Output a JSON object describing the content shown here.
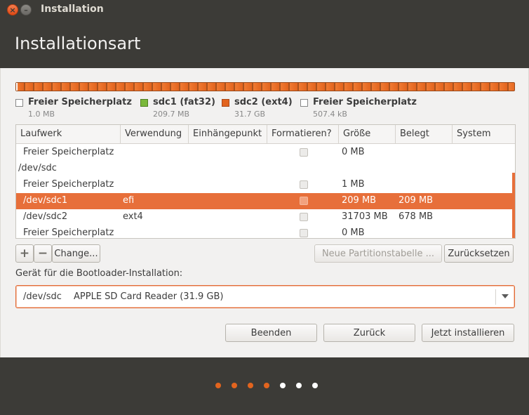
{
  "window": {
    "title": "Installation",
    "close_icon": "close-icon",
    "minimize_icon": "minimize-icon"
  },
  "header": {
    "title": "Installationsart"
  },
  "legend": [
    {
      "label": "Freier Speicherplatz",
      "size": "1.0 MB",
      "color": "#ffffff"
    },
    {
      "label": "sdc1 (fat32)",
      "size": "209.7 MB",
      "color": "#7ab83a"
    },
    {
      "label": "sdc2 (ext4)",
      "size": "31.7 GB",
      "color": "#e2641e"
    },
    {
      "label": "Freier Speicherplatz",
      "size": "507.4 kB",
      "color": "#ffffff"
    }
  ],
  "table": {
    "columns": [
      "Laufwerk",
      "Verwendung",
      "Einhängepunkt",
      "Formatieren?",
      "Größe",
      "Belegt",
      "System"
    ],
    "rows": [
      {
        "device": "Freier Speicherplatz",
        "usage": "",
        "mount": "",
        "format": true,
        "size": "0 MB",
        "used": "",
        "system": "",
        "selected": false,
        "indent": true
      },
      {
        "device": "/dev/sdc",
        "usage": "",
        "mount": "",
        "format": false,
        "size": "",
        "used": "",
        "system": "",
        "selected": false,
        "indent": false
      },
      {
        "device": "Freier Speicherplatz",
        "usage": "",
        "mount": "",
        "format": true,
        "size": "1 MB",
        "used": "",
        "system": "",
        "selected": false,
        "indent": true
      },
      {
        "device": "/dev/sdc1",
        "usage": "efi",
        "mount": "",
        "format": true,
        "size": "209 MB",
        "used": "209 MB",
        "system": "",
        "selected": true,
        "indent": true
      },
      {
        "device": "/dev/sdc2",
        "usage": "ext4",
        "mount": "",
        "format": true,
        "size": "31703 MB",
        "used": "678 MB",
        "system": "",
        "selected": false,
        "indent": true
      },
      {
        "device": "Freier Speicherplatz",
        "usage": "",
        "mount": "",
        "format": true,
        "size": "0 MB",
        "used": "",
        "system": "",
        "selected": false,
        "indent": true
      }
    ]
  },
  "toolbar": {
    "add_label": "+",
    "remove_label": "−",
    "change_label": "Change...",
    "new_table_label": "Neue Partitionstabelle ...",
    "reset_label": "Zurücksetzen"
  },
  "bootloader": {
    "label": "Gerät für die Bootloader-Installation:",
    "device": "/dev/sdc",
    "description": "APPLE SD Card Reader (31.9 GB)"
  },
  "actions": {
    "quit_label": "Beenden",
    "back_label": "Zurück",
    "install_label": "Jetzt installieren"
  },
  "progress": {
    "total_steps": 7,
    "completed_steps": 4,
    "active_color": "#e2641e",
    "inactive_color": "#ffffff"
  }
}
